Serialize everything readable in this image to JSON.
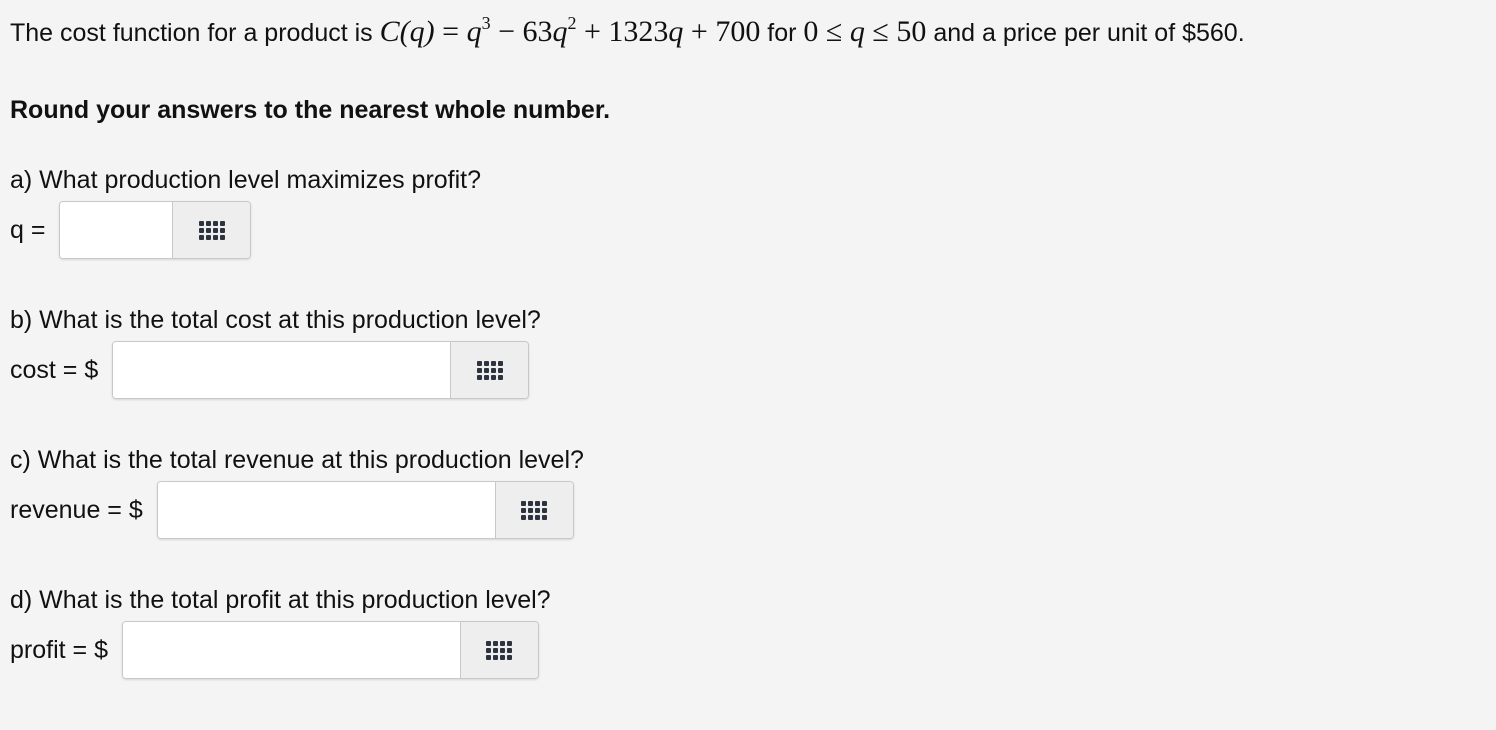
{
  "problem": {
    "intro_text": "The cost function for a product is",
    "cost_function": {
      "lhs": "C(q)",
      "q3": "q",
      "exp3": "3",
      "minus": " − 63",
      "q2": "q",
      "exp2": "2",
      "plus_linear": " + 1323",
      "q1": "q",
      "plus_const": " + 700"
    },
    "for_text": "for",
    "domain": {
      "lower": "0",
      "var": "q",
      "upper": "50"
    },
    "tail_text": "and a price per unit of $560."
  },
  "instructions": "Round your answers to the nearest whole number.",
  "questions": [
    {
      "prompt": "a) What production level maximizes profit?",
      "label": "q =",
      "value": "",
      "placeholder": ""
    },
    {
      "prompt": "b) What is the total cost at this production level?",
      "label": "cost = $",
      "value": "",
      "placeholder": ""
    },
    {
      "prompt": "c) What is the total revenue at this production level?",
      "label": "revenue = $",
      "value": "",
      "placeholder": ""
    },
    {
      "prompt": "d) What is the total profit at this production level?",
      "label": "profit = $",
      "value": "",
      "placeholder": ""
    }
  ],
  "icons": {
    "keypad": "keypad-icon"
  },
  "colors": {
    "background": "#f4f4f4",
    "input_background": "#ffffff",
    "button_background": "#eeeeee",
    "border": "#c8c8c8",
    "icon": "#2d3440"
  }
}
